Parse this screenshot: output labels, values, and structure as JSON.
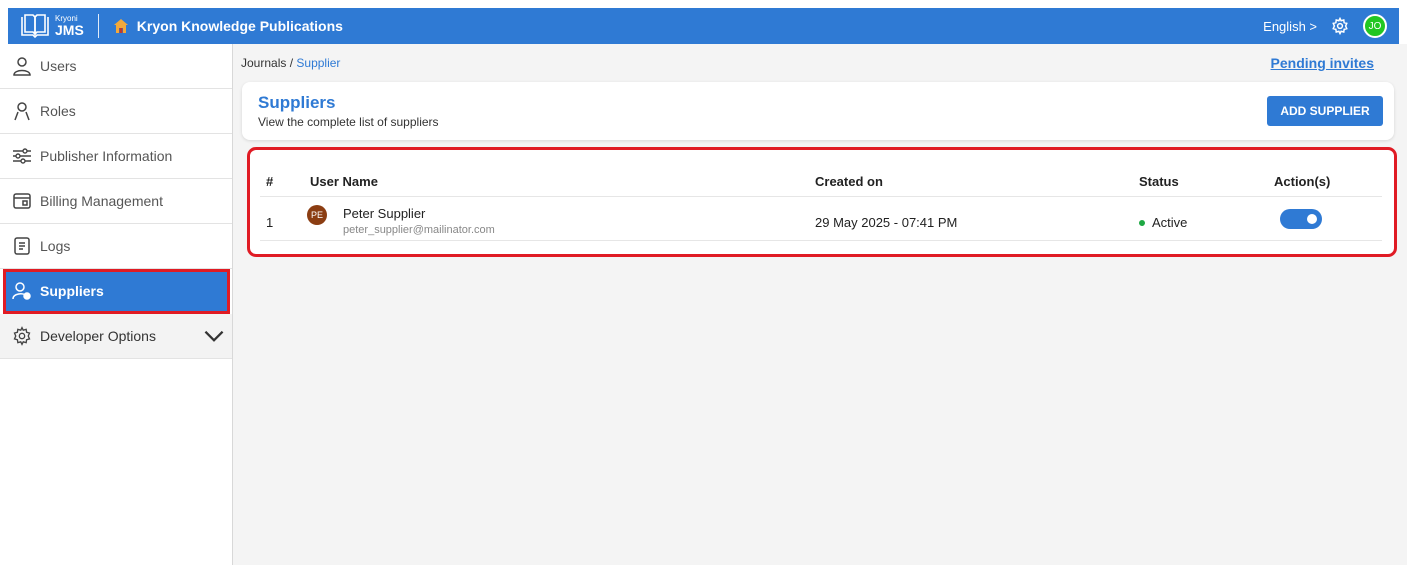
{
  "app": {
    "logo_small": "Kryoni",
    "logo_big": "JMS",
    "org_name": "Kryon Knowledge Publications",
    "language": "English >",
    "user_initials": "JO"
  },
  "sidebar": {
    "items": [
      {
        "label": "Users",
        "icon": "user-icon"
      },
      {
        "label": "Roles",
        "icon": "roles-icon"
      },
      {
        "label": "Publisher Information",
        "icon": "sliders-icon"
      },
      {
        "label": "Billing Management",
        "icon": "billing-icon"
      },
      {
        "label": "Logs",
        "icon": "logs-icon"
      },
      {
        "label": "Suppliers",
        "icon": "supplier-icon",
        "active": true
      },
      {
        "label": "Developer Options",
        "icon": "gear-icon"
      }
    ]
  },
  "breadcrumb": {
    "root": "Journals",
    "sep": "/",
    "current": "Supplier"
  },
  "pending_invites": "Pending invites",
  "header": {
    "title": "Suppliers",
    "subtitle": "View the complete list of suppliers",
    "add_button": "ADD SUPPLIER"
  },
  "table": {
    "columns": [
      "#",
      "User Name",
      "Created on",
      "Status",
      "Action(s)"
    ],
    "rows": [
      {
        "index": "1",
        "initials": "PE",
        "name": "Peter Supplier",
        "email": "peter_supplier@mailinator.com",
        "created": "29 May 2025 - 07:41 PM",
        "status": "Active",
        "enabled": true
      }
    ]
  },
  "colors": {
    "accent": "#2f7ad4",
    "highlight": "#e01b24",
    "status_active": "#1ea843"
  }
}
